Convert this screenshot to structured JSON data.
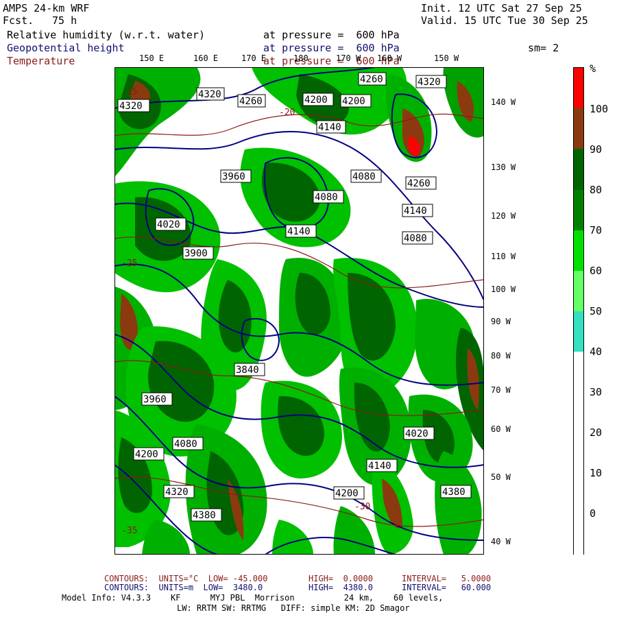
{
  "header": {
    "model": "AMPS 24-km WRF",
    "fcst_label": "Fcst.",
    "fcst_value": "75 h",
    "init": "Init. 12 UTC Sat 27 Sep 25",
    "valid": "Valid. 15 UTC Tue 30 Sep 25",
    "field1_name": "Relative humidity (w.r.t. water)",
    "field1_level": "at pressure =  600 hPa",
    "field2_name": "Geopotential height",
    "field2_level": "at pressure =  600 hPa",
    "field3_name": "Temperature",
    "field3_level": "at pressure =  600 hPa",
    "smoothing": "sm= 2"
  },
  "axes": {
    "lon_labels": [
      "150 E",
      "160 E",
      "170 E",
      "180",
      "170 W",
      "160 W",
      "150 W"
    ],
    "lat_labels": [
      "140 W",
      "130 W",
      "120 W",
      "110 W",
      "100 W",
      "90 W",
      "80 W",
      "70 W",
      "60 W",
      "50 W",
      "40 W"
    ]
  },
  "colorbar": {
    "unit": "%",
    "ticks": [
      "100",
      "90",
      "80",
      "70",
      "60",
      "50",
      "40",
      "30",
      "20",
      "10",
      "0"
    ],
    "colors": [
      "#ff0000",
      "#8b3a0f",
      "#006400",
      "#00a000",
      "#00e000",
      "#66ff66",
      "#33e0c0",
      "#ffffff"
    ]
  },
  "contour_labels": {
    "height": [
      "4260",
      "4320",
      "4320",
      "4260",
      "4200",
      "4140",
      "4080",
      "4020",
      "3960",
      "3900",
      "3840",
      "4140",
      "4080",
      "4200",
      "4320",
      "4380",
      "4260",
      "4140",
      "4080",
      "3960",
      "4020",
      "4080",
      "4200",
      "4140",
      "4200",
      "4320",
      "4380"
    ],
    "temperature": [
      "-15",
      "-20",
      "-25",
      "-30",
      "-35"
    ]
  },
  "footer": {
    "line1_label": "CONTOURS:  UNITS=°C  LOW= -45.000",
    "line1_high": "HIGH=  0.0000",
    "line1_interval": "INTERVAL=   5.0000",
    "line2_label": "CONTOURS:  UNITS=m  LOW=  3480.0",
    "line2_high": "HIGH=  4380.0",
    "line2_interval": "INTERVAL=   60.000",
    "line3": "Model Info: V4.3.3    KF      MYJ PBL  Morrison          24 km,    60 levels,",
    "line4": "LW: RRTM SW: RRTMG   DIFF: simple KM: 2D Smagor"
  }
}
